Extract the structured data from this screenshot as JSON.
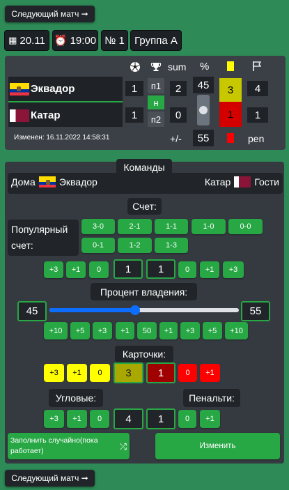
{
  "next_match_label": "Следующий матч ➞",
  "info": {
    "date": "20.11",
    "time": "19:00",
    "number": "№ 1",
    "group": "Группа A"
  },
  "scoreboard": {
    "header": {
      "sum": "sum",
      "percent": "%"
    },
    "team1": {
      "name": "Эквадор",
      "score": "1",
      "sum": "2",
      "possession": "45",
      "yellow": "3",
      "corners": "4"
    },
    "team2": {
      "name": "Катар",
      "score": "1",
      "sum": "0",
      "possession": "55",
      "red": "1",
      "corners": "1"
    },
    "half1": "п1",
    "half_n": "н",
    "half2": "п2",
    "changed": "Изменен: 16.11.2022 14:58:31",
    "plus_minus": "+/-",
    "pen": "pen"
  },
  "teams_label": "Команды",
  "home_label": "Дома",
  "away_label": "Гости",
  "home_team": "Эквадор",
  "away_team": "Катар",
  "score_label": "Счет:",
  "popular_label": "Популярный счет:",
  "popular_scores": [
    "3-0",
    "2-1",
    "1-1",
    "1-0",
    "0-0",
    "0-1",
    "1-2",
    "1-3"
  ],
  "score_controls": {
    "plus3": "+3",
    "plus1": "+1",
    "zero": "0",
    "home_value": "1",
    "away_value": "1"
  },
  "possession_label": "Процент владения:",
  "possession": {
    "home": "45",
    "away": "55",
    "slider_value": 45
  },
  "possession_buttons": [
    "+10",
    "+5",
    "+3",
    "+1",
    "50",
    "+1",
    "+3",
    "+5",
    "+10"
  ],
  "cards_label": "Карточки:",
  "cards": {
    "yellow_value": "3",
    "red_value": "1",
    "plus3": "+3",
    "plus1": "+1",
    "zero": "0"
  },
  "corners_label": "Угловые:",
  "penalties_label": "Пенальти:",
  "corners": {
    "plus3": "+3",
    "plus1": "+1",
    "zero": "0",
    "value": "4"
  },
  "penalties": {
    "value": "1",
    "zero": "0",
    "plus1": "+1"
  },
  "random_fill_label": "Заполнить случайно(пока работает)",
  "change_label": "Изменить",
  "colors": {
    "background": "#2e8b57",
    "green": "#28a745",
    "dark": "#212529",
    "panel": "#343a40",
    "yellow": "#ffff00",
    "red": "#ff0000"
  }
}
